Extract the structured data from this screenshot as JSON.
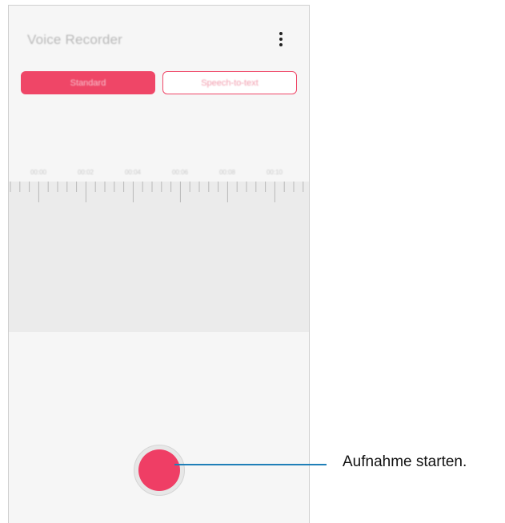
{
  "app": {
    "title": "Voice Recorder",
    "more_icon": "more-vertical-icon"
  },
  "tabs": [
    {
      "label": "Standard",
      "active": true
    },
    {
      "label": "Speech-to-text",
      "active": false
    }
  ],
  "timeline": {
    "labels": [
      "00:00",
      "00:02",
      "00:04",
      "00:06",
      "00:08",
      "00:10"
    ]
  },
  "record_button": {
    "icon": "record-icon"
  },
  "callout": {
    "text": "Aufnahme starten."
  },
  "colors": {
    "accent": "#ef4667",
    "record": "#ef3e65",
    "leader_line": "#1f7fb8",
    "background": "#f6f6f6",
    "waveform_area": "#ebebeb"
  }
}
